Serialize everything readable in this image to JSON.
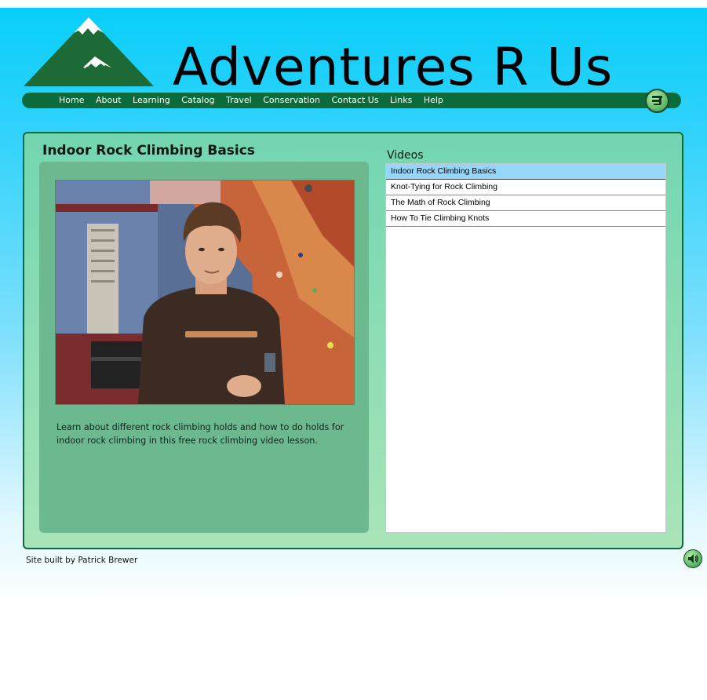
{
  "site": {
    "title": "Adventures R Us"
  },
  "nav": {
    "items": [
      "Home",
      "About",
      "Learning",
      "Catalog",
      "Travel",
      "Conservation",
      "Contact Us",
      "Links",
      "Help"
    ]
  },
  "main": {
    "page_title": "Indoor Rock Climbing Basics",
    "description": "Learn about different rock climbing holds and how to do holds for indoor rock climbing in this free rock climbing video lesson."
  },
  "videos": {
    "heading": "Videos",
    "selected_index": 0,
    "items": [
      "Indoor Rock Climbing Basics",
      "Knot-Tying for Rock Climbing",
      "The Math of Rock Climbing",
      "How To Tie Climbing Knots"
    ]
  },
  "footer": {
    "credit": "Site built by Patrick Brewer"
  },
  "icons": {
    "cart": "shopping-cart-icon",
    "sound": "speaker-icon",
    "logo": "mountain-logo"
  },
  "colors": {
    "sky_top": "#08cff9",
    "nav_bar": "#0c6b3a",
    "panel": "#72d6b1",
    "selected_item": "#96d6fb"
  }
}
